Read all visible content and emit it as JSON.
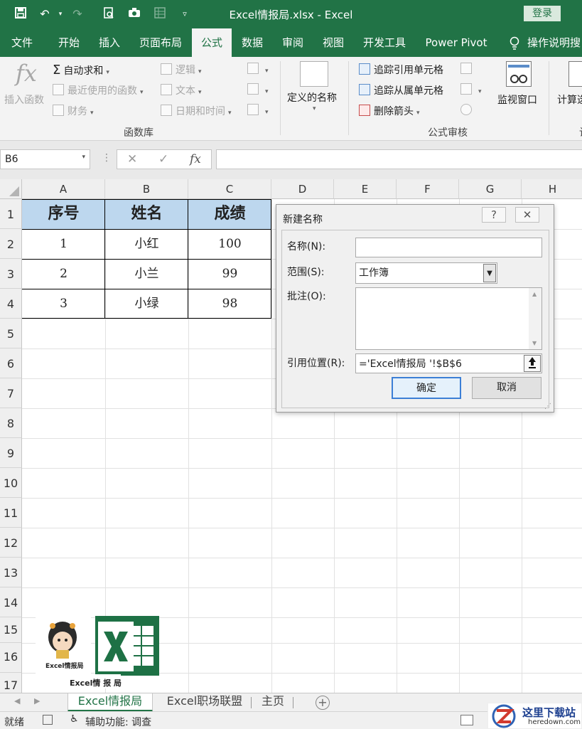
{
  "titlebar": {
    "title": "Excel情报局.xlsx  -  Excel",
    "login": "登录",
    "icons": [
      "save-icon",
      "undo-icon",
      "redo-icon",
      "print-preview-icon",
      "camera-icon",
      "grid-icon",
      "customize-icon"
    ]
  },
  "tabs": [
    "文件",
    "开始",
    "插入",
    "页面布局",
    "公式",
    "数据",
    "审阅",
    "视图",
    "开发工具",
    "Power Pivot",
    "操作说明搜"
  ],
  "active_tab": "公式",
  "ribbon": {
    "insert_function": "插入函数",
    "autosum": "自动求和",
    "recent": "最近使用的函数",
    "finance": "财务",
    "logic": "逻辑",
    "text": "文本",
    "datetime": "日期和时间",
    "group_function_library": "函数库",
    "defined_names": "定义的名称",
    "trace_precedents": "追踪引用单元格",
    "trace_dependents": "追踪从属单元格",
    "remove_arrows": "删除箭头",
    "group_formula_audit": "公式审核",
    "watch_window": "监视窗口",
    "calculation": "计算选",
    "calc_group_partial": "计"
  },
  "formula_bar": {
    "name_box": "B6",
    "cancel": "✕",
    "enter": "✓",
    "fx": "fx"
  },
  "grid": {
    "columns": [
      "A",
      "B",
      "C",
      "D",
      "E",
      "F",
      "G",
      "H"
    ],
    "rows": [
      "1",
      "2",
      "3",
      "4",
      "5",
      "6",
      "7",
      "8",
      "9",
      "10",
      "11",
      "12",
      "13",
      "14",
      "15",
      "16",
      "17"
    ]
  },
  "table": {
    "headers": [
      "序号",
      "姓名",
      "成绩"
    ],
    "rows": [
      [
        "1",
        "小红",
        "100"
      ],
      [
        "2",
        "小兰",
        "99"
      ],
      [
        "3",
        "小绿",
        "98"
      ]
    ]
  },
  "dialog": {
    "title": "新建名称",
    "help": "?",
    "close": "✕",
    "name_label": "名称(N):",
    "name_value": "",
    "scope_label": "范围(S):",
    "scope_value": "工作簿",
    "comment_label": "批注(O):",
    "comment_value": "",
    "refers_label": "引用位置(R):",
    "refers_value": "='Excel情报局 '!$B$6",
    "ok": "确定",
    "cancel": "取消"
  },
  "logo": {
    "caption": "Excel情报局",
    "tagline": "Excel情 报 局"
  },
  "sheet_tabs": [
    "Excel情报局",
    "Excel职场联盟",
    "主页"
  ],
  "active_sheet": "Excel情报局",
  "statusbar": {
    "ready": "就绪",
    "accessibility": "辅助功能: 调查"
  },
  "watermark": {
    "name": "这里下载站",
    "url": "heredown.com"
  }
}
